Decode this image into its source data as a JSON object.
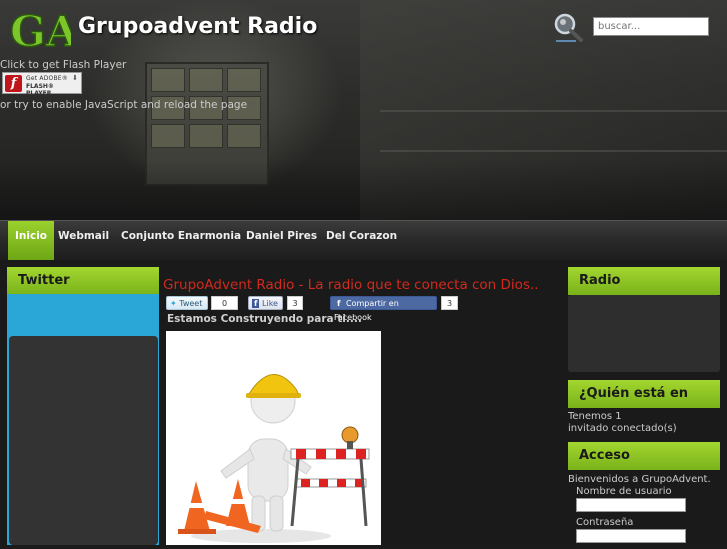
{
  "header": {
    "site_title": "Grupoadvent Radio",
    "logo_text": "GA",
    "flash_line1": "Click to get Flash Player",
    "flash_badge_line1": "Get ADOBE®",
    "flash_badge_line2": "FLASH® PLAYER",
    "flash_line2": "or try to enable JavaScript and reload the page",
    "search_placeholder": "buscar...",
    "search_icon": "search-icon"
  },
  "nav": {
    "items": [
      {
        "label": "Inicio",
        "active": true
      },
      {
        "label": "Webmail"
      },
      {
        "label": "Conjunto Enarmonia"
      },
      {
        "label": "Daniel Pires"
      },
      {
        "label": "Del Corazon"
      }
    ]
  },
  "left": {
    "twitter_title": "Twitter"
  },
  "main": {
    "title": "GrupoAdvent Radio - La radio que te conecta con Dios..",
    "tweet_label": "Tweet",
    "tweet_count": "0",
    "like_label": "Like",
    "like_count": "3",
    "share_label": "Compartir en Facebook",
    "share_count": "3",
    "subtitle": "Estamos Construyendo para ti...."
  },
  "right": {
    "radio_title": "Radio",
    "quien_title": "¿Quién está en línea?",
    "quien_line1": "Tenemos 1",
    "quien_line2": "invitado conectado(s)",
    "acceso_title": "Acceso",
    "acceso_welcome": "Bienvenidos a GrupoAdvent.",
    "user_label": "Nombre de usuario",
    "pass_label": "Contraseña"
  },
  "colors": {
    "accent_green": "#8cc424",
    "title_red": "#d12a1c",
    "twitter_blue": "#2aa7d6"
  }
}
